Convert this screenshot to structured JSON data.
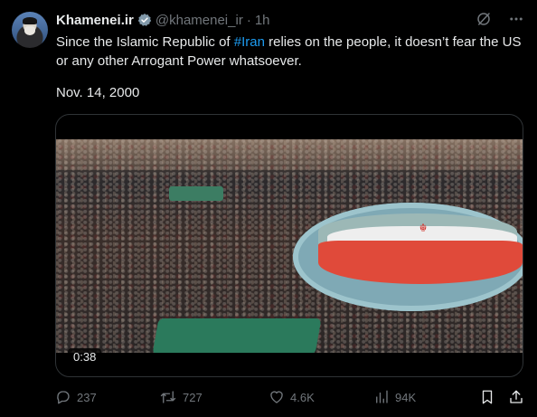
{
  "author": {
    "name": "Khamenei.ir",
    "handle": "@khamenei_ir",
    "separator": "·",
    "time": "1h"
  },
  "tweet": {
    "text_before": "Since the Islamic Republic of ",
    "hashtag": "#Iran",
    "text_after": " relies on the people, it doesn’t fear the US or any other Arrogant Power whatsoever.",
    "date": "Nov. 14, 2000"
  },
  "media": {
    "duration": "0:38"
  },
  "actions": {
    "replies": "237",
    "reposts": "727",
    "likes": "4.6K",
    "views": "94K"
  },
  "colors": {
    "background": "#000000",
    "text": "#e7e9ea",
    "muted": "#71767b",
    "link": "#1d9bf0",
    "verified": "#829aab"
  },
  "icons": {
    "verified": "verified-badge-icon",
    "grok": "grok-icon",
    "more": "more-icon",
    "reply": "reply-icon",
    "repost": "repost-icon",
    "like": "heart-icon",
    "views": "views-icon",
    "bookmark": "bookmark-icon",
    "share": "share-icon"
  }
}
